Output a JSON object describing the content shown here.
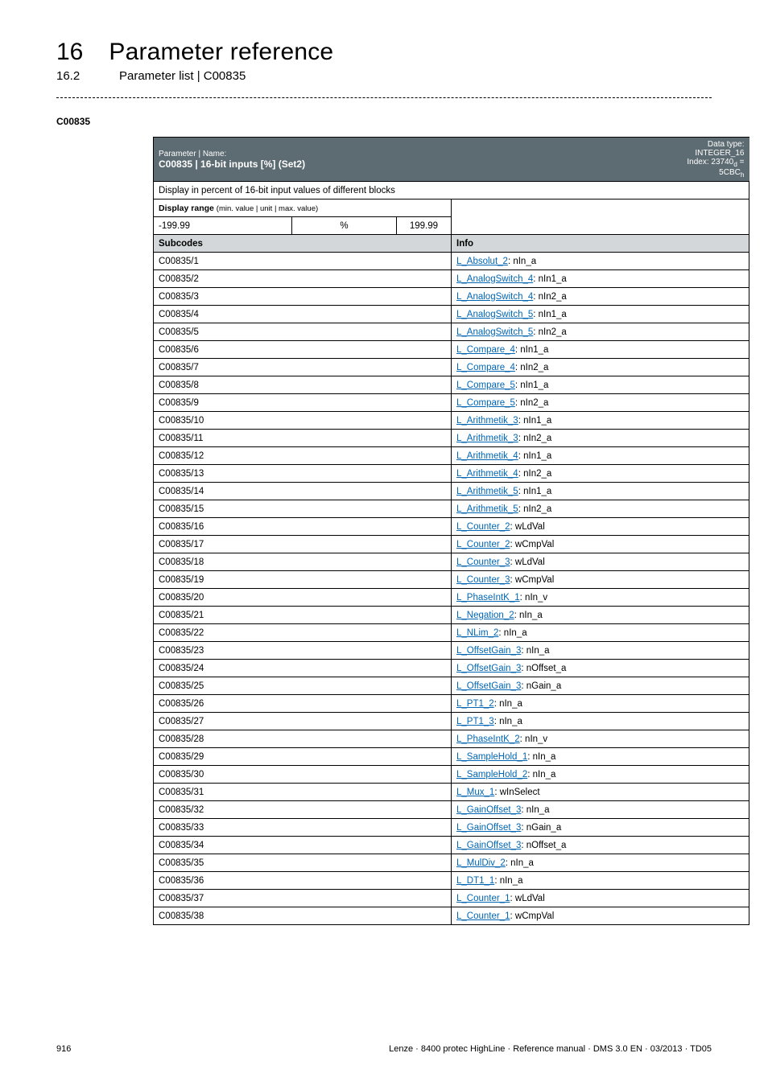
{
  "header": {
    "chapter_num": "16",
    "chapter_title": "Parameter reference",
    "section_num": "16.2",
    "section_title": "Parameter list | C00835"
  },
  "code_label": "C00835",
  "paramrow": {
    "pn_label": "Parameter | Name:",
    "pn_value": "C00835 | 16-bit inputs [%] (Set2)",
    "dt_line1": "Data type: INTEGER_16",
    "dt_line2": "Index: 23740",
    "dt_sub1": "d",
    "dt_eq": " = 5CBC",
    "dt_sub2": "h"
  },
  "desc": "Display in percent of 16-bit input values of different blocks",
  "disp_label": "Display range ",
  "disp_note": "(min. value | unit | max. value)",
  "range_min": "-199.99",
  "range_unit": "%",
  "range_max": "199.99",
  "subhdr_left": "Subcodes",
  "subhdr_right": "Info",
  "rows": [
    {
      "code": "C00835/1",
      "link": "L_Absolut_2",
      "rest": ": nIn_a"
    },
    {
      "code": "C00835/2",
      "link": "L_AnalogSwitch_4",
      "rest": ": nIn1_a"
    },
    {
      "code": "C00835/3",
      "link": "L_AnalogSwitch_4",
      "rest": ": nIn2_a"
    },
    {
      "code": "C00835/4",
      "link": "L_AnalogSwitch_5",
      "rest": ": nIn1_a"
    },
    {
      "code": "C00835/5",
      "link": "L_AnalogSwitch_5",
      "rest": ": nIn2_a"
    },
    {
      "code": "C00835/6",
      "link": "L_Compare_4",
      "rest": ": nIn1_a"
    },
    {
      "code": "C00835/7",
      "link": "L_Compare_4",
      "rest": ": nIn2_a"
    },
    {
      "code": "C00835/8",
      "link": "L_Compare_5",
      "rest": ": nIn1_a"
    },
    {
      "code": "C00835/9",
      "link": "L_Compare_5",
      "rest": ": nIn2_a"
    },
    {
      "code": "C00835/10",
      "link": "L_Arithmetik_3",
      "rest": ": nIn1_a"
    },
    {
      "code": "C00835/11",
      "link": "L_Arithmetik_3",
      "rest": ": nIn2_a"
    },
    {
      "code": "C00835/12",
      "link": "L_Arithmetik_4",
      "rest": ": nIn1_a"
    },
    {
      "code": "C00835/13",
      "link": "L_Arithmetik_4",
      "rest": ": nIn2_a"
    },
    {
      "code": "C00835/14",
      "link": "L_Arithmetik_5",
      "rest": ": nIn1_a"
    },
    {
      "code": "C00835/15",
      "link": "L_Arithmetik_5",
      "rest": ": nIn2_a"
    },
    {
      "code": "C00835/16",
      "link": "L_Counter_2",
      "rest": ": wLdVal"
    },
    {
      "code": "C00835/17",
      "link": "L_Counter_2",
      "rest": ": wCmpVal"
    },
    {
      "code": "C00835/18",
      "link": "L_Counter_3",
      "rest": ": wLdVal"
    },
    {
      "code": "C00835/19",
      "link": "L_Counter_3",
      "rest": ": wCmpVal"
    },
    {
      "code": "C00835/20",
      "link": "L_PhaseIntK_1",
      "rest": ": nIn_v"
    },
    {
      "code": "C00835/21",
      "link": "L_Negation_2",
      "rest": ": nIn_a"
    },
    {
      "code": "C00835/22",
      "link": "L_NLim_2",
      "rest": ": nIn_a"
    },
    {
      "code": "C00835/23",
      "link": "L_OffsetGain_3",
      "rest": ": nIn_a"
    },
    {
      "code": "C00835/24",
      "link": "L_OffsetGain_3",
      "rest": ": nOffset_a"
    },
    {
      "code": "C00835/25",
      "link": "L_OffsetGain_3",
      "rest": ": nGain_a"
    },
    {
      "code": "C00835/26",
      "link": "L_PT1_2",
      "rest": ": nIn_a"
    },
    {
      "code": "C00835/27",
      "link": "L_PT1_3",
      "rest": ": nIn_a"
    },
    {
      "code": "C00835/28",
      "link": "L_PhaseIntK_2",
      "rest": ": nIn_v"
    },
    {
      "code": "C00835/29",
      "link": "L_SampleHold_1",
      "rest": ": nIn_a"
    },
    {
      "code": "C00835/30",
      "link": "L_SampleHold_2",
      "rest": ": nIn_a"
    },
    {
      "code": "C00835/31",
      "link": "L_Mux_1",
      "rest": ": wInSelect"
    },
    {
      "code": "C00835/32",
      "link": "L_GainOffset_3",
      "rest": ": nIn_a"
    },
    {
      "code": "C00835/33",
      "link": "L_GainOffset_3",
      "rest": ": nGain_a"
    },
    {
      "code": "C00835/34",
      "link": "L_GainOffset_3",
      "rest": ": nOffset_a"
    },
    {
      "code": "C00835/35",
      "link": "L_MulDiv_2",
      "rest": ": nIn_a"
    },
    {
      "code": "C00835/36",
      "link": "L_DT1_1",
      "rest": ": nIn_a"
    },
    {
      "code": "C00835/37",
      "link": "L_Counter_1",
      "rest": ": wLdVal"
    },
    {
      "code": "C00835/38",
      "link": "L_Counter_1",
      "rest": ": wCmpVal"
    }
  ],
  "footer": {
    "page": "916",
    "meta": "Lenze · 8400 protec HighLine · Reference manual · DMS 3.0 EN · 03/2013 · TD05"
  }
}
